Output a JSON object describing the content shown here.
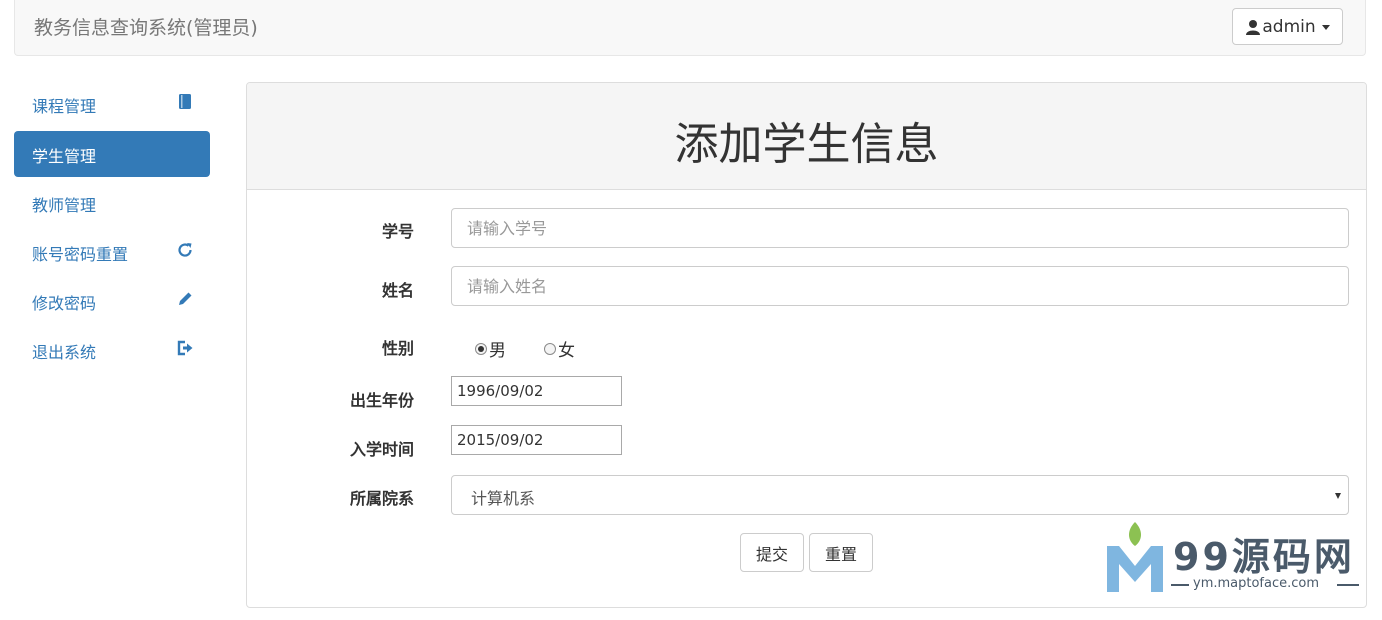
{
  "navbar": {
    "brand": "教务信息查询系统(管理员)",
    "user_menu_label": "admin"
  },
  "sidebar": {
    "items": [
      {
        "label": "课程管理",
        "icon": "book-icon",
        "active": false
      },
      {
        "label": "学生管理",
        "icon": "",
        "active": true
      },
      {
        "label": "教师管理",
        "icon": "",
        "active": false
      },
      {
        "label": "账号密码重置",
        "icon": "refresh-icon",
        "active": false
      },
      {
        "label": "修改密码",
        "icon": "pencil-icon",
        "active": false
      },
      {
        "label": "退出系统",
        "icon": "logout-icon",
        "active": false
      }
    ]
  },
  "form": {
    "title": "添加学生信息",
    "student_id": {
      "label": "学号",
      "value": "",
      "placeholder": "请输入学号"
    },
    "name": {
      "label": "姓名",
      "value": "",
      "placeholder": "请输入姓名"
    },
    "gender": {
      "label": "性别",
      "options": [
        "男",
        "女"
      ],
      "selected": "男"
    },
    "birth_date": {
      "label": "出生年份",
      "value": "1996/09/02"
    },
    "enroll_date": {
      "label": "入学时间",
      "value": "2015/09/02"
    },
    "department": {
      "label": "所属院系",
      "selected": "计算机系"
    },
    "submit_label": "提交",
    "reset_label": "重置"
  },
  "watermark": {
    "text": "99源码网",
    "url": "ym.maptoface.com"
  },
  "colors": {
    "primary": "#337ab7",
    "navbar_bg": "#f8f8f8",
    "panel_heading_bg": "#f5f5f5"
  }
}
